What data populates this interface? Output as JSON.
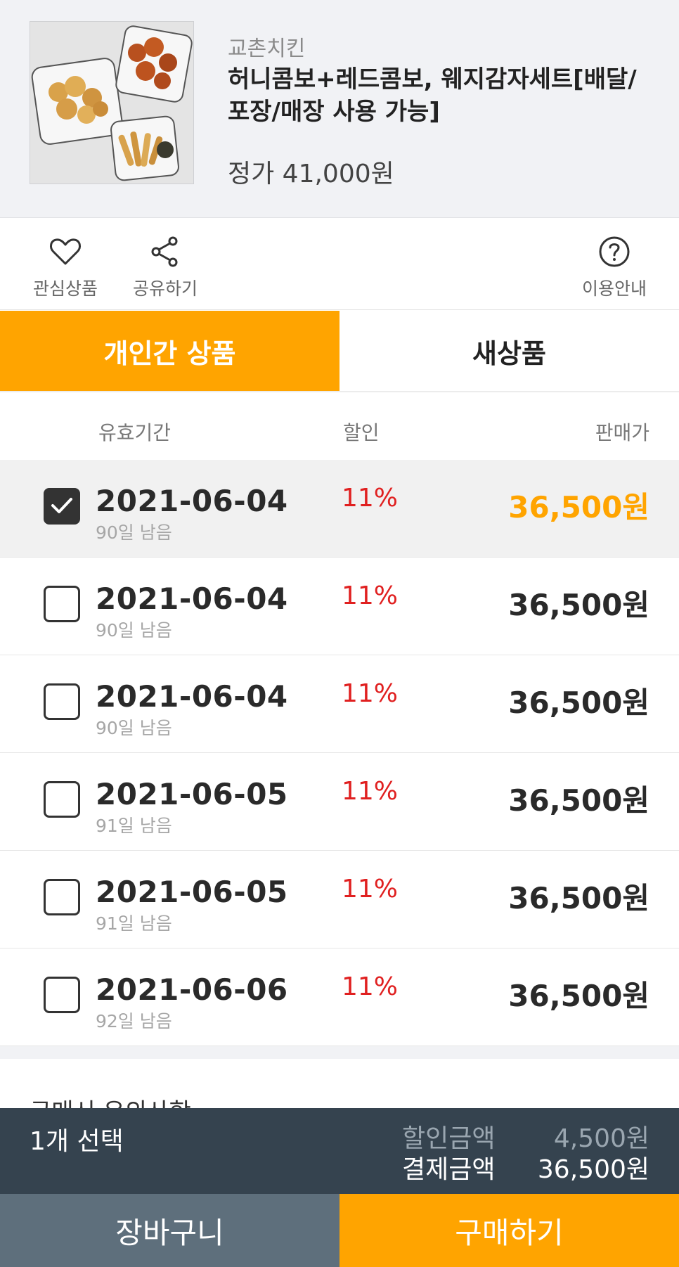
{
  "product": {
    "brand": "교촌치킨",
    "title": "허니콤보+레드콤보, 웨지감자세트[배달/포장/매장 사용 가능]",
    "list_price": "정가 41,000원"
  },
  "actions": {
    "favorite": "관심상품",
    "share": "공유하기",
    "guide": "이용안내"
  },
  "tabs": [
    {
      "label": "개인간 상품",
      "active": true
    },
    {
      "label": "새상품",
      "active": false
    }
  ],
  "columns": {
    "validity": "유효기간",
    "discount": "할인",
    "price": "판매가"
  },
  "rows": [
    {
      "date": "2021-06-04",
      "remain": "90일 남음",
      "discount": "11%",
      "price": "36,500원",
      "checked": true
    },
    {
      "date": "2021-06-04",
      "remain": "90일 남음",
      "discount": "11%",
      "price": "36,500원",
      "checked": false
    },
    {
      "date": "2021-06-04",
      "remain": "90일 남음",
      "discount": "11%",
      "price": "36,500원",
      "checked": false
    },
    {
      "date": "2021-06-05",
      "remain": "91일 남음",
      "discount": "11%",
      "price": "36,500원",
      "checked": false
    },
    {
      "date": "2021-06-05",
      "remain": "91일 남음",
      "discount": "11%",
      "price": "36,500원",
      "checked": false
    },
    {
      "date": "2021-06-06",
      "remain": "92일 남음",
      "discount": "11%",
      "price": "36,500원",
      "checked": false
    }
  ],
  "notice": "구매시 유의사항",
  "summary": {
    "selected": "1개 선택",
    "discount_label": "할인금액",
    "discount_value": "4,500원",
    "pay_label": "결제금액",
    "pay_value": "36,500원"
  },
  "buttons": {
    "cart": "장바구니",
    "buy": "구매하기"
  },
  "colors": {
    "accent": "#ffa400",
    "discount": "#e02020",
    "summary_bg": "#35434f",
    "cart_bg": "#5e6f7c"
  }
}
